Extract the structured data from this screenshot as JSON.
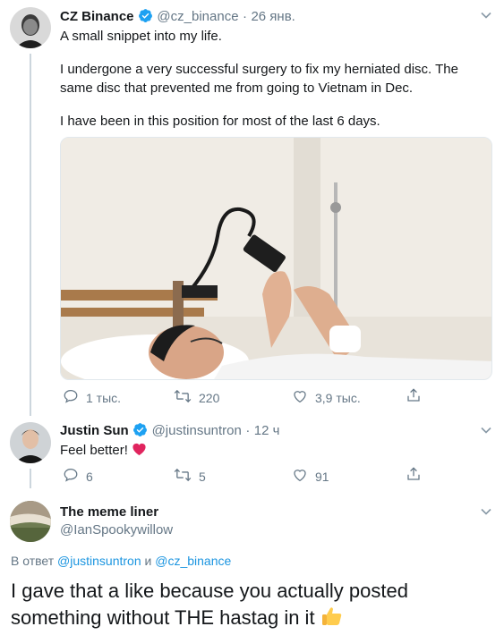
{
  "tweet1": {
    "name": "CZ Binance",
    "handle": "@cz_binance",
    "sep": "·",
    "date": "26 янв.",
    "line1": "A small snippet into my life.",
    "para2_l1": "I undergone a very successful surgery to fix my herniated disc. The",
    "para2_l2": "same disc that prevented me from going to Vietnam in Dec.",
    "para3": "I have been in this position for most of the last 6 days.",
    "replies": "1 тыс.",
    "retweets": "220",
    "likes": "3,9 тыс."
  },
  "tweet2": {
    "name": "Justin Sun",
    "handle": "@justinsuntron",
    "sep": "·",
    "time": "12 ч",
    "text": "Feel better!",
    "replies": "6",
    "retweets": "5",
    "likes": "91"
  },
  "tweet3": {
    "name": "The meme liner",
    "handle": "@IanSpookywillow",
    "reply_prefix": "В ответ",
    "reply_to_1": "@justinsuntron",
    "reply_and": "и",
    "reply_to_2": "@cz_binance",
    "text_l1": "I gave that a like because you actually posted",
    "text_l2": "something without THE hastag in it"
  },
  "colors": {
    "verified": "#1da1f2",
    "link": "#1b95e0",
    "secondary_text": "#657786",
    "heart": "#e0245e"
  },
  "icons": [
    "verified-badge-icon",
    "chevron-down-icon",
    "reply-icon",
    "retweet-icon",
    "like-icon",
    "share-icon",
    "red-heart-emoji-icon",
    "thumbs-up-emoji-icon"
  ]
}
